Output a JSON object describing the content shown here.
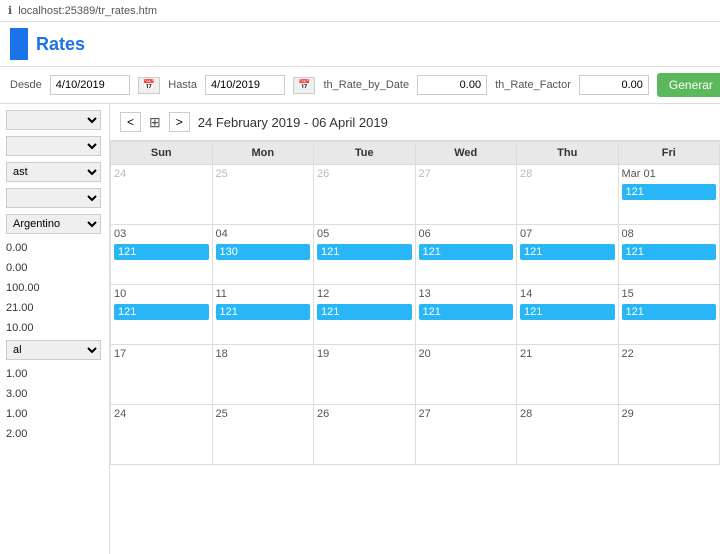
{
  "topbar": {
    "url": "localhost:25389/tr_rates.htm",
    "info_icon": "ℹ"
  },
  "header": {
    "title": "Rates"
  },
  "toolbar": {
    "desde_label": "Desde",
    "hasta_label": "Hasta",
    "th_rate_by_date_label": "th_Rate_by_Date",
    "th_rate_factor_label": "th_Rate_Factor",
    "desde_value": "4/10/2019",
    "hasta_value": "4/10/2019",
    "th_rate_by_date_value": "0.00",
    "th_rate_factor_value": "0.00",
    "generar_label": "Generar"
  },
  "calendar": {
    "nav": {
      "prev": "<",
      "next": ">",
      "date_range": "24 February 2019 - 06 April 2019"
    },
    "days": [
      "Sun",
      "Mon",
      "Tue",
      "Wed",
      "Thu",
      "Fri"
    ],
    "weeks": [
      [
        {
          "date": "24",
          "other": true,
          "event": null
        },
        {
          "date": "25",
          "other": true,
          "event": null
        },
        {
          "date": "26",
          "other": true,
          "event": null
        },
        {
          "date": "27",
          "other": true,
          "event": null
        },
        {
          "date": "28",
          "other": true,
          "event": null
        },
        {
          "date": "Mar 01",
          "other": false,
          "event": "121"
        }
      ],
      [
        {
          "date": "03",
          "other": false,
          "event": "121"
        },
        {
          "date": "04",
          "other": false,
          "event": "130"
        },
        {
          "date": "05",
          "other": false,
          "event": "121"
        },
        {
          "date": "06",
          "other": false,
          "event": "121"
        },
        {
          "date": "07",
          "other": false,
          "event": "121"
        },
        {
          "date": "08",
          "other": false,
          "event": "121"
        }
      ],
      [
        {
          "date": "10",
          "other": false,
          "event": "121"
        },
        {
          "date": "11",
          "other": false,
          "event": "121"
        },
        {
          "date": "12",
          "other": false,
          "event": "121"
        },
        {
          "date": "13",
          "other": false,
          "event": "121"
        },
        {
          "date": "14",
          "other": false,
          "event": "121"
        },
        {
          "date": "15",
          "other": false,
          "event": "121"
        }
      ],
      [
        {
          "date": "17",
          "other": false,
          "event": null
        },
        {
          "date": "18",
          "other": false,
          "event": null
        },
        {
          "date": "19",
          "other": false,
          "event": null
        },
        {
          "date": "20",
          "other": false,
          "event": null
        },
        {
          "date": "21",
          "other": false,
          "event": null
        },
        {
          "date": "22",
          "other": false,
          "event": null
        }
      ],
      [
        {
          "date": "24",
          "other": false,
          "event": null
        },
        {
          "date": "25",
          "other": false,
          "event": null
        },
        {
          "date": "26",
          "other": false,
          "event": null
        },
        {
          "date": "27",
          "other": false,
          "event": null
        },
        {
          "date": "28",
          "other": false,
          "event": null
        },
        {
          "date": "29",
          "other": false,
          "event": null
        }
      ]
    ]
  },
  "sidebar": {
    "dropdowns": [
      "",
      "",
      "ast",
      ""
    ],
    "argentino_label": "Argentino",
    "values": [
      "0.00",
      "0.00",
      "100.00",
      "21.00",
      "10.00"
    ],
    "bottom_dropdown": "al",
    "bottom_values": [
      "1.00",
      "3.00",
      "1.00",
      "2.00"
    ]
  }
}
